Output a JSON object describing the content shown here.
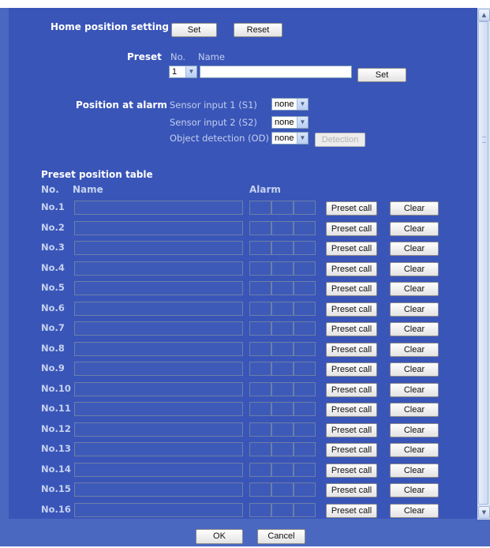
{
  "home": {
    "label": "Home position setting",
    "set_label": "Set",
    "reset_label": "Reset"
  },
  "preset": {
    "label": "Preset",
    "no_header": "No.",
    "name_header": "Name",
    "selected_no": "1",
    "name_value": "",
    "set_label": "Set"
  },
  "alarm": {
    "label": "Position at alarm",
    "s1_label": "Sensor input 1 (S1)",
    "s1_value": "none",
    "s2_label": "Sensor input 2 (S2)",
    "s2_value": "none",
    "od_label": "Object detection (OD)",
    "od_value": "none",
    "detection_label": "Detection"
  },
  "table": {
    "title": "Preset position table",
    "col_no": "No.",
    "col_name": "Name",
    "col_alarm": "Alarm",
    "preset_call_label": "Preset call",
    "clear_label": "Clear",
    "rows": [
      {
        "no": "No.1",
        "name": ""
      },
      {
        "no": "No.2",
        "name": ""
      },
      {
        "no": "No.3",
        "name": ""
      },
      {
        "no": "No.4",
        "name": ""
      },
      {
        "no": "No.5",
        "name": ""
      },
      {
        "no": "No.6",
        "name": ""
      },
      {
        "no": "No.7",
        "name": ""
      },
      {
        "no": "No.8",
        "name": ""
      },
      {
        "no": "No.9",
        "name": ""
      },
      {
        "no": "No.10",
        "name": ""
      },
      {
        "no": "No.11",
        "name": ""
      },
      {
        "no": "No.12",
        "name": ""
      },
      {
        "no": "No.13",
        "name": ""
      },
      {
        "no": "No.14",
        "name": ""
      },
      {
        "no": "No.15",
        "name": ""
      },
      {
        "no": "No.16",
        "name": ""
      }
    ]
  },
  "footer": {
    "ok_label": "OK",
    "cancel_label": "Cancel"
  },
  "colors": {
    "panel": "#3a55b8",
    "page": "#4a68c0",
    "label": "#ffffff",
    "muted": "#c2cfee"
  },
  "icons": {
    "dropdown": "chevron-down-icon",
    "scroll_up": "scroll-up-arrow-icon",
    "scroll_down": "scroll-down-arrow-icon"
  }
}
